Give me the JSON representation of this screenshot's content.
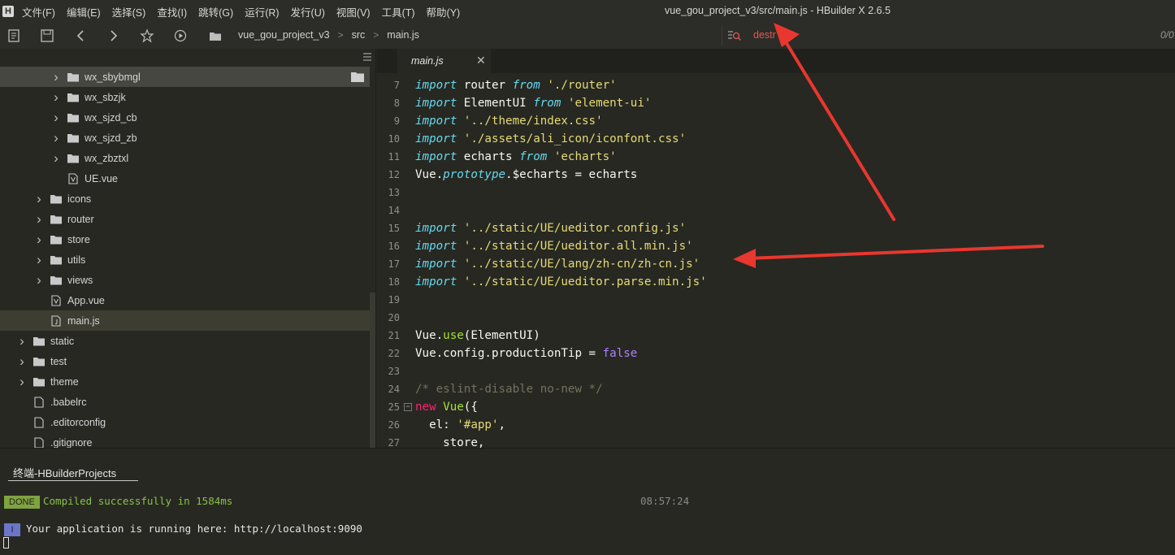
{
  "app": {
    "logo_letter": "H",
    "window_title": "vue_gou_project_v3/src/main.js - HBuilder X 2.6.5"
  },
  "menu": [
    {
      "label": "文件(F)"
    },
    {
      "label": "编辑(E)"
    },
    {
      "label": "选择(S)"
    },
    {
      "label": "查找(I)"
    },
    {
      "label": "跳转(G)"
    },
    {
      "label": "运行(R)"
    },
    {
      "label": "发行(U)"
    },
    {
      "label": "视图(V)"
    },
    {
      "label": "工具(T)"
    },
    {
      "label": "帮助(Y)"
    }
  ],
  "toolbar": {
    "breadcrumb": [
      "vue_gou_project_v3",
      "src",
      "main.js"
    ],
    "search_value": "destr",
    "search_count": "0/0"
  },
  "sidebar": {
    "items": [
      {
        "label": "wx_sbybmgl",
        "type": "folder",
        "depth": 3,
        "expandable": true,
        "state": "hover"
      },
      {
        "label": "wx_sbzjk",
        "type": "folder",
        "depth": 3,
        "expandable": true
      },
      {
        "label": "wx_sjzd_cb",
        "type": "folder",
        "depth": 3,
        "expandable": true
      },
      {
        "label": "wx_sjzd_zb",
        "type": "folder",
        "depth": 3,
        "expandable": true
      },
      {
        "label": "wx_zbztxl",
        "type": "folder",
        "depth": 3,
        "expandable": true
      },
      {
        "label": "UE.vue",
        "type": "vue",
        "depth": 3,
        "expandable": false
      },
      {
        "label": "icons",
        "type": "folder",
        "depth": 2,
        "expandable": true
      },
      {
        "label": "router",
        "type": "folder",
        "depth": 2,
        "expandable": true
      },
      {
        "label": "store",
        "type": "folder",
        "depth": 2,
        "expandable": true
      },
      {
        "label": "utils",
        "type": "folder",
        "depth": 2,
        "expandable": true
      },
      {
        "label": "views",
        "type": "folder",
        "depth": 2,
        "expandable": true
      },
      {
        "label": "App.vue",
        "type": "vue",
        "depth": 2,
        "expandable": false
      },
      {
        "label": "main.js",
        "type": "js",
        "depth": 2,
        "expandable": false,
        "state": "selected"
      },
      {
        "label": "static",
        "type": "folder",
        "depth": 1,
        "expandable": true
      },
      {
        "label": "test",
        "type": "folder",
        "depth": 1,
        "expandable": true
      },
      {
        "label": "theme",
        "type": "folder",
        "depth": 1,
        "expandable": true
      },
      {
        "label": ".babelrc",
        "type": "file",
        "depth": 1,
        "expandable": false
      },
      {
        "label": ".editorconfig",
        "type": "file",
        "depth": 1,
        "expandable": false
      },
      {
        "label": ".gitignore",
        "type": "file",
        "depth": 1,
        "expandable": false
      }
    ]
  },
  "editor": {
    "tab_label": "main.js",
    "lines": [
      {
        "n": "7",
        "tokens": [
          [
            "kw",
            "import"
          ],
          [
            "plain",
            " router "
          ],
          [
            "kw",
            "from"
          ],
          [
            "plain",
            " "
          ],
          [
            "str",
            "'./router'"
          ]
        ]
      },
      {
        "n": "8",
        "tokens": [
          [
            "kw",
            "import"
          ],
          [
            "plain",
            " ElementUI "
          ],
          [
            "kw",
            "from"
          ],
          [
            "plain",
            " "
          ],
          [
            "str",
            "'element-ui'"
          ]
        ]
      },
      {
        "n": "9",
        "tokens": [
          [
            "kw",
            "import"
          ],
          [
            "plain",
            " "
          ],
          [
            "str",
            "'../theme/index.css'"
          ]
        ]
      },
      {
        "n": "10",
        "tokens": [
          [
            "kw",
            "import"
          ],
          [
            "plain",
            " "
          ],
          [
            "str",
            "'./assets/ali_icon/iconfont.css'"
          ]
        ]
      },
      {
        "n": "11",
        "tokens": [
          [
            "kw",
            "import"
          ],
          [
            "plain",
            " echarts "
          ],
          [
            "kw",
            "from"
          ],
          [
            "plain",
            " "
          ],
          [
            "str",
            "'echarts'"
          ]
        ]
      },
      {
        "n": "12",
        "tokens": [
          [
            "plain",
            "Vue."
          ],
          [
            "prop",
            "prototype"
          ],
          [
            "plain",
            ".$echarts = echarts"
          ]
        ]
      },
      {
        "n": "13",
        "tokens": []
      },
      {
        "n": "14",
        "tokens": []
      },
      {
        "n": "15",
        "tokens": [
          [
            "kw",
            "import"
          ],
          [
            "plain",
            " "
          ],
          [
            "str",
            "'../static/UE/ueditor.config.js'"
          ]
        ]
      },
      {
        "n": "16",
        "tokens": [
          [
            "kw",
            "import"
          ],
          [
            "plain",
            " "
          ],
          [
            "str",
            "'../static/UE/ueditor.all.min.js'"
          ]
        ]
      },
      {
        "n": "17",
        "tokens": [
          [
            "kw",
            "import"
          ],
          [
            "plain",
            " "
          ],
          [
            "str",
            "'../static/UE/lang/zh-cn/zh-cn.js'"
          ]
        ]
      },
      {
        "n": "18",
        "tokens": [
          [
            "kw",
            "import"
          ],
          [
            "plain",
            " "
          ],
          [
            "str",
            "'../static/UE/ueditor.parse.min.js'"
          ]
        ]
      },
      {
        "n": "19",
        "tokens": []
      },
      {
        "n": "20",
        "tokens": []
      },
      {
        "n": "21",
        "tokens": [
          [
            "plain",
            "Vue."
          ],
          [
            "fn",
            "use"
          ],
          [
            "plain",
            "(ElementUI)"
          ]
        ]
      },
      {
        "n": "22",
        "tokens": [
          [
            "plain",
            "Vue.config.productionTip = "
          ],
          [
            "bool",
            "false"
          ]
        ]
      },
      {
        "n": "23",
        "tokens": []
      },
      {
        "n": "24",
        "tokens": [
          [
            "cmt",
            "/* eslint-disable no-new */"
          ]
        ]
      },
      {
        "n": "25",
        "fold": true,
        "tokens": [
          [
            "kwp",
            "new"
          ],
          [
            "plain",
            " "
          ],
          [
            "fn",
            "Vue"
          ],
          [
            "plain",
            "({"
          ]
        ]
      },
      {
        "n": "26",
        "tokens": [
          [
            "plain",
            "  el: "
          ],
          [
            "str",
            "'#app'"
          ],
          [
            "plain",
            ","
          ]
        ]
      },
      {
        "n": "27",
        "tokens": [
          [
            "plain",
            "    store,"
          ]
        ]
      }
    ]
  },
  "terminal": {
    "tab_label": "终端-HBuilderProjects",
    "done_badge": "DONE",
    "compiled_text": "Compiled successfully in 1584ms",
    "compiled_time": "08:57:24",
    "info_badge": "I",
    "running_text": "Your application is running here: http://localhost:9090"
  },
  "colors": {
    "background": "#272822",
    "keyword": "#66d9ef",
    "string": "#e6db74",
    "function": "#a6e22e",
    "comment": "#75715e",
    "annotation_arrow": "#e8372f"
  }
}
